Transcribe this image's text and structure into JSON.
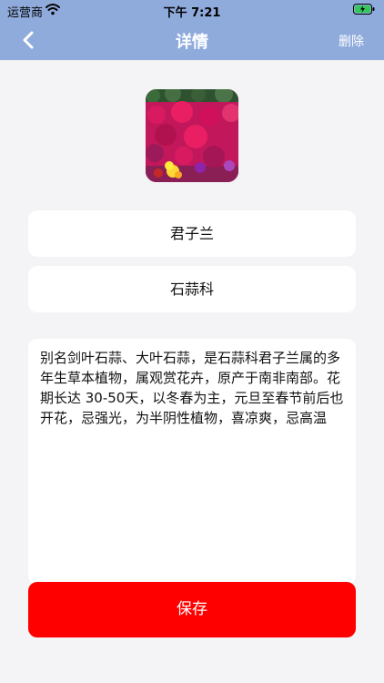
{
  "status_bar": {
    "carrier": "运营商",
    "time": "下午 7:21"
  },
  "nav": {
    "title": "详情",
    "delete_label": "删除"
  },
  "flower": {
    "name": "君子兰",
    "family": "石蒜科",
    "description": "别名剑叶石蒜、大叶石蒜，是石蒜科君子兰属的多年生草本植物，属观赏花卉，原产于南非南部。花期长达 30-50天，以冬春为主，元旦至春节前后也开花，忌强光，为半阴性植物，喜凉爽，忌高温"
  },
  "save_label": "保存",
  "colors": {
    "nav_background": "#8fabdc",
    "save_button": "#ff0000",
    "page_background": "#f4f4f6"
  }
}
